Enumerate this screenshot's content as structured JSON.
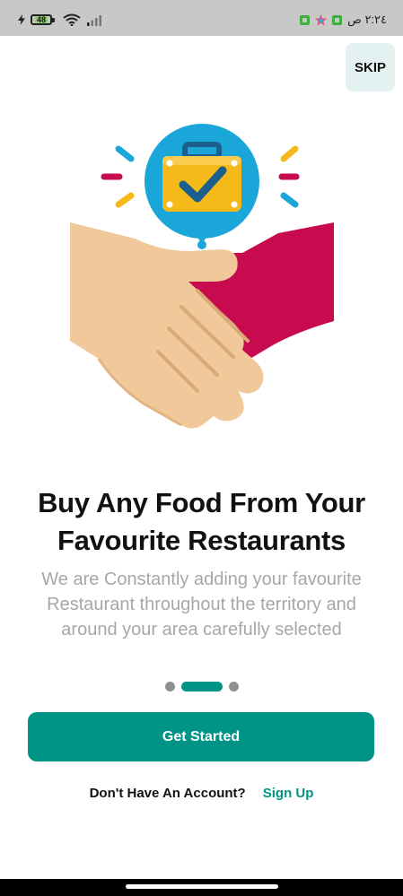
{
  "status_bar": {
    "battery": "48",
    "time": "٢:٢٤ ص",
    "icons": [
      "charging-bolt-icon",
      "battery-icon",
      "wifi-icon",
      "signal-icon",
      "notification-icon",
      "app-star-icon",
      "notification-icon"
    ],
    "bg_color": "#c8c8c8"
  },
  "header": {
    "skip_label": "SKIP"
  },
  "illustration": {
    "name": "handshake-briefcase-illustration",
    "colors": {
      "circle": "#1aa6d9",
      "briefcase": "#f6b91a",
      "check": "#1c5e8c",
      "left_hand": "#f0c89a",
      "right_hand": "#c80a4e"
    }
  },
  "onboarding": {
    "title_line1": "Buy Any Food From Your",
    "title_line2": "Favourite Restaurants",
    "description_line1": "We are Constantly adding your favourite",
    "description_line2": "Restaurant throughout the territory and",
    "description_line3": "around your area carefully selected",
    "page_indicator": {
      "count": 3,
      "active": 2
    }
  },
  "actions": {
    "get_started_label": "Get Started",
    "account_question": "Don't Have An Account?",
    "signup_label": "Sign Up"
  },
  "theme": {
    "accent": "#009486",
    "muted_text": "#a7a7a7"
  }
}
